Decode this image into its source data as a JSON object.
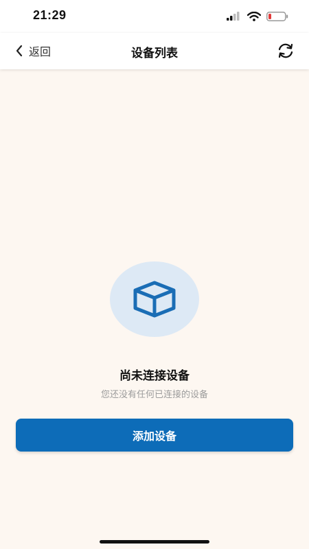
{
  "status_bar": {
    "time": "21:29",
    "icons": [
      "signal-icon",
      "wifi-icon",
      "battery-low-icon"
    ],
    "battery_color": "#e23b3b"
  },
  "nav": {
    "back_label": "返回",
    "title": "设备列表",
    "back_icon": "chevron-left-icon",
    "refresh_icon": "refresh-icon"
  },
  "empty_state": {
    "icon": "cube-icon",
    "title": "尚未连接设备",
    "subtitle": "您还没有任何已连接的设备"
  },
  "actions": {
    "add_device_label": "添加设备"
  },
  "colors": {
    "accent": "#0d6cb8",
    "background": "#fdf7f1",
    "illustration_bg": "#dde9f5",
    "icon_blue": "#1a6db5"
  }
}
